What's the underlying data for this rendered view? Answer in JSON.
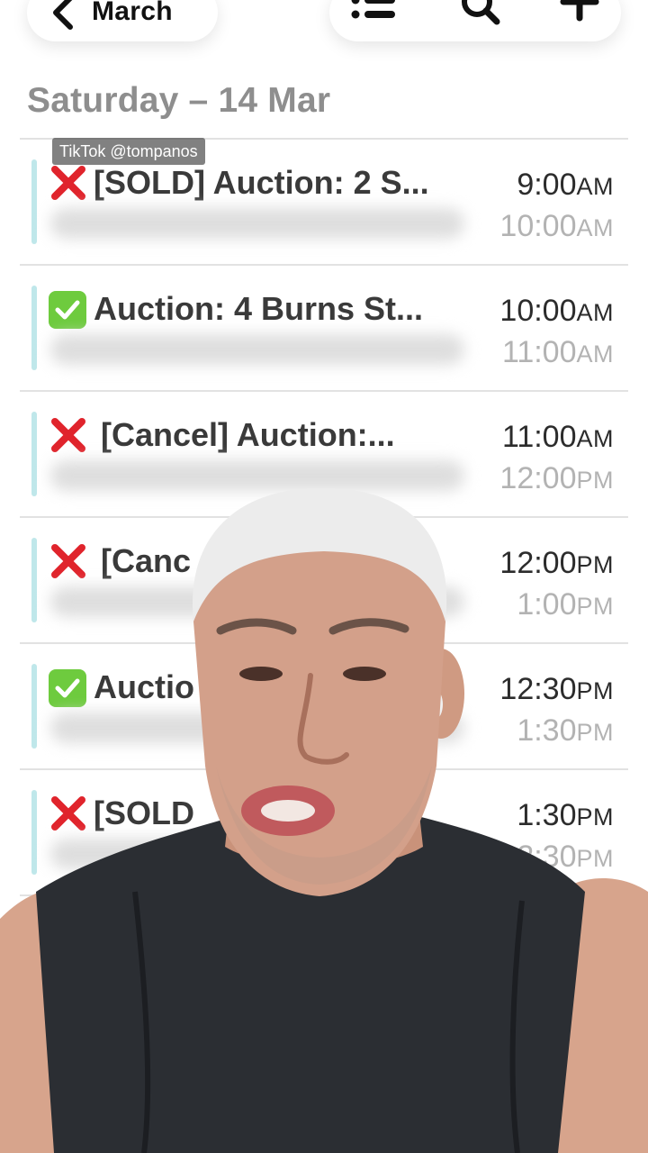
{
  "nav": {
    "back_label": "March",
    "icons": [
      "chevron-left-icon",
      "list-icon",
      "search-icon",
      "plus-icon"
    ]
  },
  "day_header": "Saturday – 14 Mar",
  "watermark": "TikTok @tompanos",
  "events": [
    {
      "status": "cross",
      "title": "[SOLD] Auction: 2 S...",
      "start": "9:00",
      "start_ampm": "AM",
      "end": "10:00",
      "end_ampm": "AM"
    },
    {
      "status": "check",
      "title": "Auction: 4 Burns St...",
      "start": "10:00",
      "start_ampm": "AM",
      "end": "11:00",
      "end_ampm": "AM"
    },
    {
      "status": "cross",
      "title": "[Cancel] Auction:...",
      "start": "11:00",
      "start_ampm": "AM",
      "end": "12:00",
      "end_ampm": "PM"
    },
    {
      "status": "cross",
      "title": "[Canc",
      "start": "12:00",
      "start_ampm": "PM",
      "end": "1:00",
      "end_ampm": "PM"
    },
    {
      "status": "check",
      "title": "Auctio",
      "start": "12:30",
      "start_ampm": "PM",
      "end": "1:30",
      "end_ampm": "PM"
    },
    {
      "status": "cross",
      "title": "[SOLD",
      "start": "1:30",
      "start_ampm": "PM",
      "end": "2:30",
      "end_ampm": "PM"
    }
  ],
  "colors": {
    "accent_bar": "#bfe7ea",
    "cross_red": "#e0242c",
    "check_green": "#6ecb3e",
    "header_grey": "#8e8e8e"
  }
}
